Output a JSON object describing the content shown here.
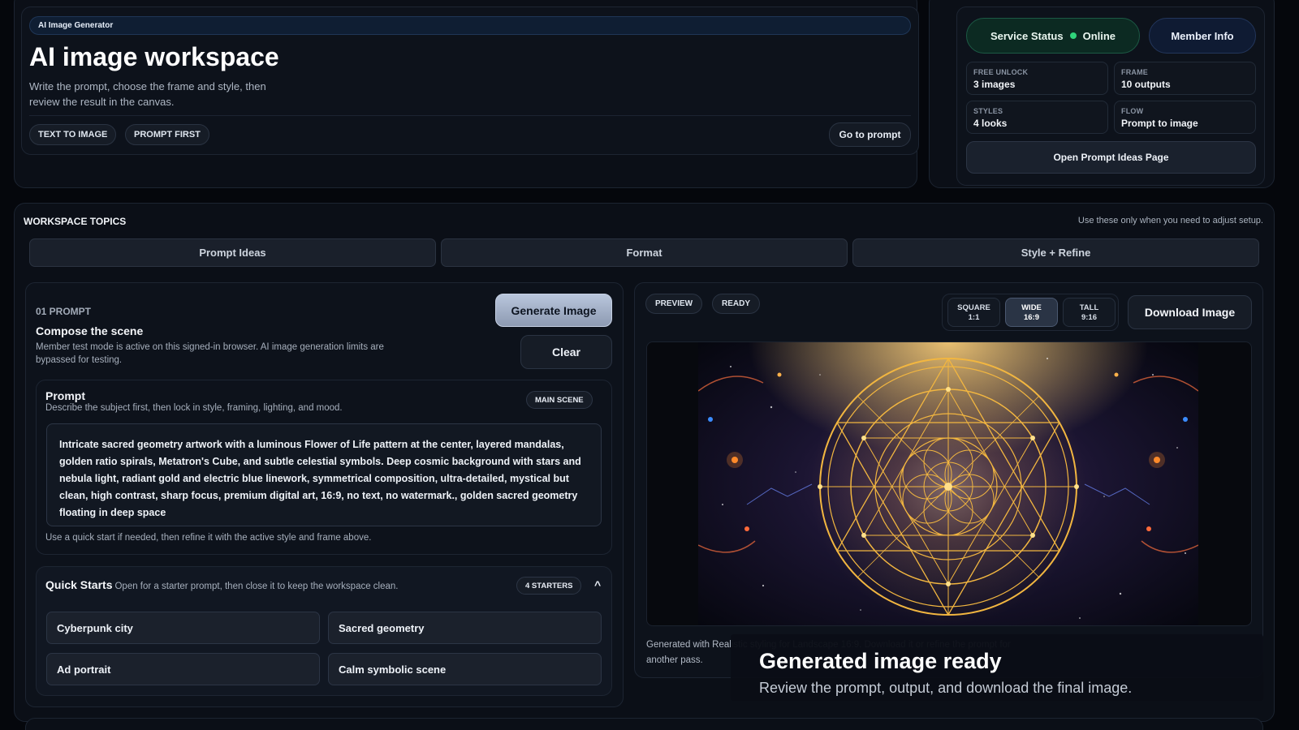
{
  "hero": {
    "tag": "AI Image Generator",
    "title": "AI image workspace",
    "subtitle": "Write the prompt, choose the frame and style, then review the result in the canvas.",
    "chips": [
      "TEXT TO IMAGE",
      "PROMPT FIRST"
    ],
    "go_to_prompt": "Go to prompt"
  },
  "status": {
    "service_label": "Service Status",
    "service_state": "Online",
    "member_info": "Member Info",
    "stats": [
      {
        "key": "FREE UNLOCK",
        "value": "3 images"
      },
      {
        "key": "FRAME",
        "value": "10 outputs"
      },
      {
        "key": "STYLES",
        "value": "4 looks"
      },
      {
        "key": "FLOW",
        "value": "Prompt to image"
      }
    ],
    "open_ideas": "Open Prompt Ideas Page"
  },
  "topics": {
    "heading": "WORKSPACE TOPICS",
    "note": "Use these only when you need to adjust setup.",
    "tabs": [
      "Prompt Ideas",
      "Format",
      "Style + Refine"
    ]
  },
  "prompt_section": {
    "tag": "01 PROMPT",
    "title": "Compose the scene",
    "description": "Member test mode is active on this signed-in browser. AI image generation limits are bypassed for testing.",
    "generate_label": "Generate Image",
    "clear_label": "Clear",
    "box_title": "Prompt",
    "box_subtitle": "Describe the subject first, then lock in style, framing, lighting, and mood.",
    "box_badge": "MAIN SCENE",
    "prompt_text": "Intricate sacred geometry artwork with a luminous Flower of Life pattern at the center, layered mandalas, golden ratio spirals, Metatron's Cube, and subtle celestial symbols. Deep cosmic background with stars and nebula light, radiant gold and electric blue linework, symmetrical composition, ultra-detailed, mystical but clean, high contrast, sharp focus, premium digital art, 16:9, no text, no watermark., golden sacred geometry floating in deep space",
    "hint": "Use a quick start if needed, then refine it with the active style and frame above."
  },
  "quick_starts": {
    "title": "Quick Starts",
    "subtitle": "Open for a starter prompt, then close it to keep the workspace clean.",
    "count_badge": "4 STARTERS",
    "toggle_glyph": "^",
    "items": [
      "Cyberpunk city",
      "Sacred geometry",
      "Ad portrait",
      "Calm symbolic scene"
    ]
  },
  "preview": {
    "badges": [
      "PREVIEW",
      "READY"
    ],
    "ratios": [
      {
        "name": "SQUARE",
        "value": "1:1"
      },
      {
        "name": "WIDE",
        "value": "16:9"
      },
      {
        "name": "TALL",
        "value": "9:16"
      }
    ],
    "active_ratio": "WIDE",
    "download_label": "Download Image",
    "note": "Generated with Realistic styling for Landscape 16:9. Download it or refine the prompt for another pass."
  },
  "toast": {
    "title": "Generated image ready",
    "subtitle": "Review the prompt, output, and download the final image."
  },
  "colors": {
    "background": "#05070c",
    "panel": "#0b0f17",
    "online": "#2fd37a",
    "gold": "#f2b640",
    "electric_blue": "#3b8cff"
  }
}
